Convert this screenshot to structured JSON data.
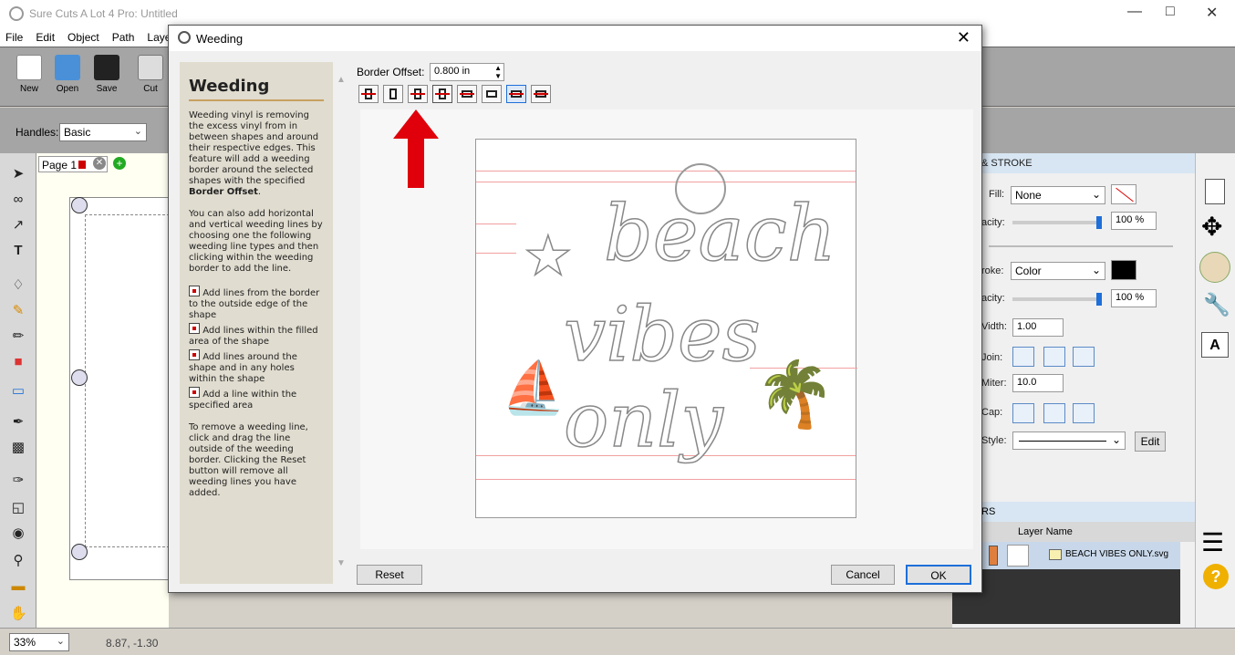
{
  "app": {
    "title": "Sure Cuts A Lot 4 Pro: Untitled"
  },
  "menu": [
    "File",
    "Edit",
    "Object",
    "Path",
    "Layer"
  ],
  "toolbar": {
    "new": "New",
    "open": "Open",
    "save": "Save",
    "cut": "Cut"
  },
  "options": {
    "handles_label": "Handles:",
    "handles_value": "Basic"
  },
  "page_tab": {
    "label": "Page 1"
  },
  "status": {
    "zoom": "33%",
    "coords": "8.87, -1.30"
  },
  "dialog": {
    "title": "Weeding",
    "border_offset_label": "Border Offset:",
    "border_offset_value": "0.800 in",
    "reset_label": "Reset",
    "cancel_label": "Cancel",
    "ok_label": "OK",
    "help": {
      "heading": "Weeding",
      "p1": "Weeding vinyl is removing the excess vinyl from in between shapes and around their respective edges. This feature will add a weeding border around the selected shapes with the specified ",
      "p1_bold": "Border Offset",
      "p1_end": ".",
      "p2": "You can also add horizontal and vertical weeding lines by choosing one the following weeding line types and then clicking within the weeding border to add the line.",
      "item1": "Add lines from the border to the outside edge of the shape",
      "item2": "Add lines within the filled area of the shape",
      "item3": "Add lines around the shape and in any holes within the shape",
      "item4": "Add a line within the specified area",
      "p3": "To remove a weeding line, click and drag the line outside of the weeding border. Clicking the Reset button will remove all weeding lines you have added."
    },
    "design_text": {
      "line1": "beach",
      "line2": "vibes",
      "line3": "only"
    }
  },
  "stroke_panel": {
    "header": "& STROKE",
    "fill_label": "Fill:",
    "fill_value": "None",
    "fill_opacity_label": "acity:",
    "fill_opacity": "100 %",
    "stroke_label": "roke:",
    "stroke_value": "Color",
    "stroke_opacity_label": "acity:",
    "stroke_opacity": "100 %",
    "width_label": "Vidth:",
    "width_value": "1.00",
    "join_label": "Join:",
    "miter_label": "Miter:",
    "miter_value": "10.0",
    "cap_label": "Cap:",
    "style_label": "Style:",
    "edit_label": "Edit"
  },
  "layers_panel": {
    "header": "RS",
    "col": "Layer Name",
    "layer": "BEACH VIBES ONLY.svg"
  },
  "colors": {
    "accent": "#1e6fd9",
    "weed_line": "#e33",
    "arrow": "#e0000b"
  }
}
